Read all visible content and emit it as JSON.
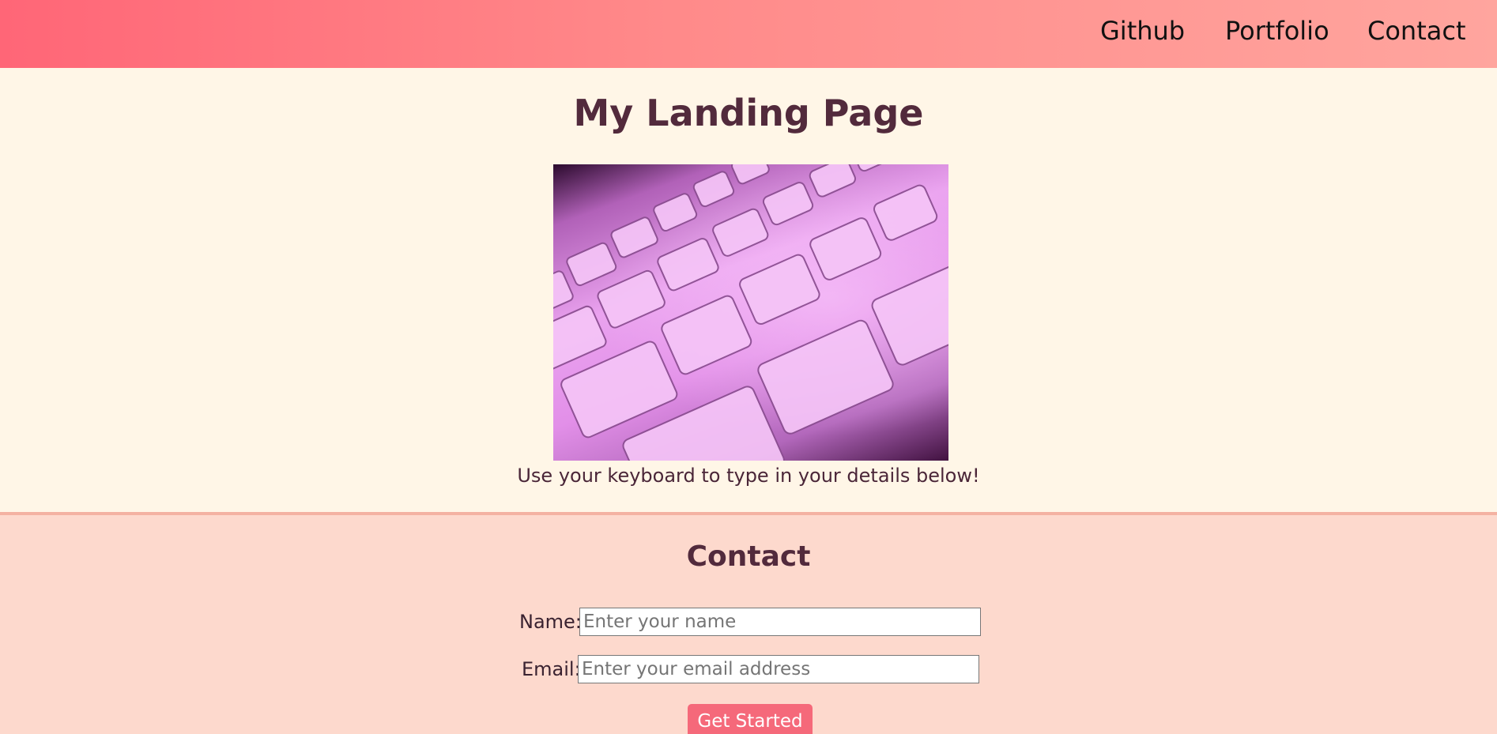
{
  "nav": {
    "links": [
      {
        "label": "Github"
      },
      {
        "label": "Portfolio"
      },
      {
        "label": "Contact"
      }
    ]
  },
  "hero": {
    "title": "My Landing Page",
    "image_alt": "Keyboard",
    "caption": "Use your keyboard to type in your details below!"
  },
  "contact": {
    "title": "Contact",
    "name_label": "Name:",
    "name_placeholder": "Enter your name",
    "email_label": "Email:",
    "email_placeholder": "Enter your email address",
    "submit_label": "Get Started"
  },
  "colors": {
    "nav_gradient_start": "#ff6677",
    "nav_gradient_end": "#ffa59e",
    "hero_background": "#fff6e7",
    "contact_background": "#fdd9cd",
    "heading_text": "#522a3c",
    "button_background": "#f5697a"
  }
}
